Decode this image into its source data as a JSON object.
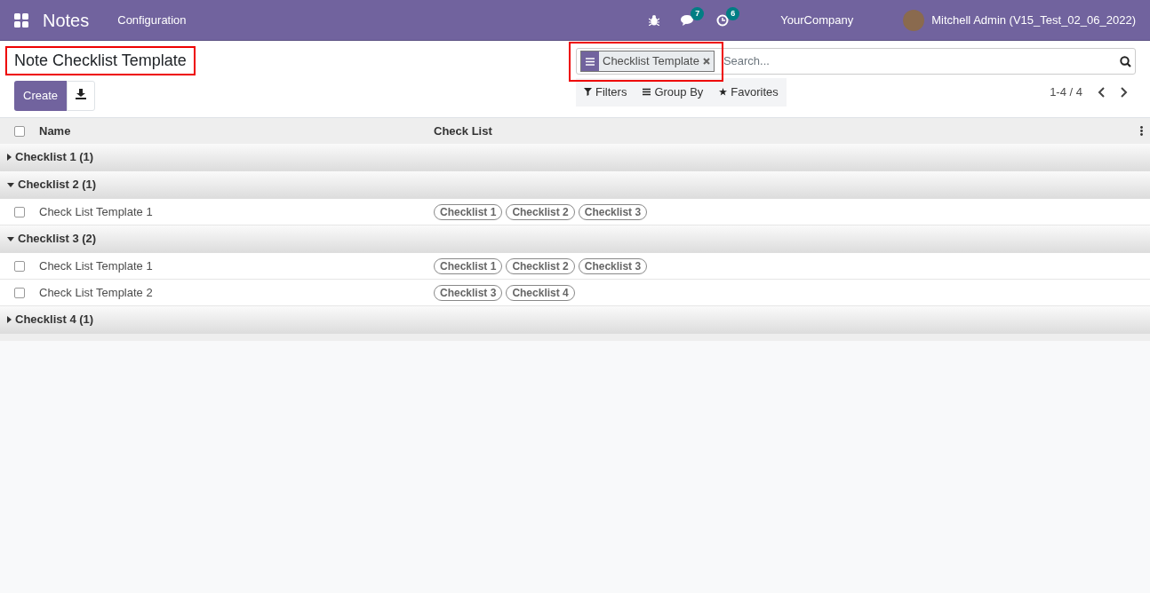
{
  "navbar": {
    "app_name": "Notes",
    "menu": [
      "Configuration"
    ],
    "messages_count": "7",
    "activities_count": "6",
    "company": "YourCompany",
    "user": "Mitchell Admin (V15_Test_02_06_2022)"
  },
  "control_panel": {
    "title": "Note Checklist Template",
    "title_highlighted": true,
    "create_label": "Create",
    "search": {
      "facet": "Checklist Template",
      "facet_highlighted": true,
      "placeholder": "Search..."
    },
    "filters": [
      "Filters",
      "Group By",
      "Favorites"
    ],
    "pager": "1-4 / 4"
  },
  "table": {
    "select_all_checked": false,
    "columns": [
      "Name",
      "Check List"
    ],
    "groups": [
      {
        "label": "Checklist 1 (1)",
        "expanded": false
      },
      {
        "label": "Checklist 2 (1)",
        "expanded": true,
        "rows": [
          {
            "name": "Check List Template 1",
            "checked": false,
            "tags": [
              "Checklist 1",
              "Checklist 2",
              "Checklist 3"
            ]
          }
        ]
      },
      {
        "label": "Checklist 3 (2)",
        "expanded": true,
        "rows": [
          {
            "name": "Check List Template 1",
            "checked": false,
            "tags": [
              "Checklist 1",
              "Checklist 2",
              "Checklist 3"
            ]
          },
          {
            "name": "Check List Template 2",
            "checked": false,
            "tags": [
              "Checklist 3",
              "Checklist 4"
            ]
          }
        ]
      },
      {
        "label": "Checklist 4 (1)",
        "expanded": false
      }
    ]
  }
}
